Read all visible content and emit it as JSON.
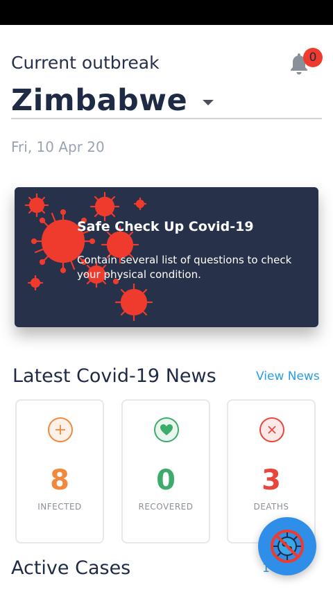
{
  "header": {
    "outbreak_label": "Current outbreak",
    "notification_count": "0",
    "country": "Zimbabwe",
    "date": "Fri, 10 Apr 20"
  },
  "checkup_card": {
    "title": "Safe Check Up Covid-19",
    "description": "Contain several list of questions to check your physical condition."
  },
  "news": {
    "title": "Latest Covid-19 News",
    "view_label": "View News"
  },
  "stats": [
    {
      "label": "INFECTED",
      "value": "8",
      "icon": "plus-icon",
      "color": "#f0893c"
    },
    {
      "label": "RECOVERED",
      "value": "0",
      "icon": "heart-icon",
      "color": "#3cab6b"
    },
    {
      "label": "DEATHS",
      "value": "3",
      "icon": "close-icon",
      "color": "#e8463d"
    }
  ],
  "active_cases": {
    "title": "Active Cases",
    "link_label": "14 Mar"
  },
  "colors": {
    "accent": "#2a9de0",
    "card_bg": "#27314a",
    "virus": "#ef3b2d"
  }
}
